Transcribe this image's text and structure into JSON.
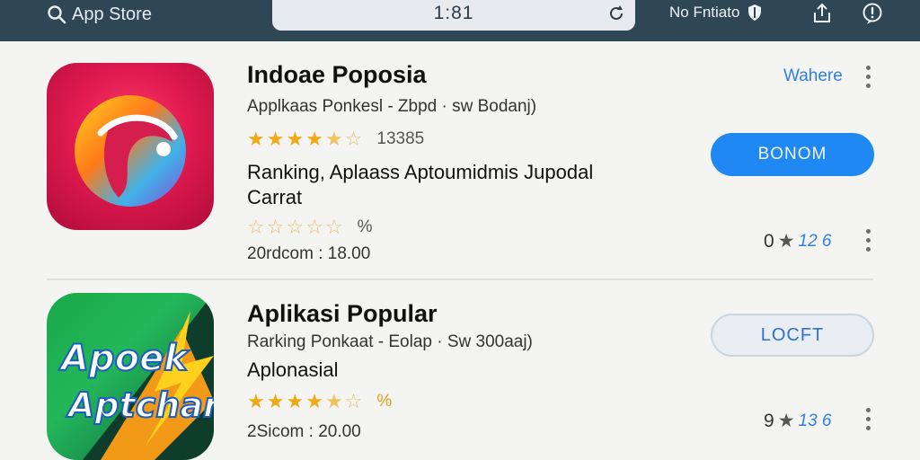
{
  "topbar": {
    "back_label": "App Store",
    "url_text": "1:81",
    "status_text": "No Fntiato"
  },
  "apps": [
    {
      "title": "Indoae Poposia",
      "subtitle": "Applkaas Ponkesl  -  Zbpd · sw  Bodanj)",
      "rating_count": "13385",
      "description_line1": "Ranking,  Aplaass Aptoumidmis Jupodal",
      "description_line2": "Carrat",
      "secondary_rating_text": "%",
      "meta": "20rdcom  :  18.00",
      "link_label": "Wahere",
      "button_label": "BONOM",
      "mini_rating_value": "0",
      "mini_rating_label": "12 6"
    },
    {
      "title": "Aplikasi Popular",
      "subtitle": "Rarking Ponkaat  -  Eolap · Sw  300aaj)",
      "description_line1": "Aplonasial",
      "rating_text": "%",
      "meta": "2Sicom  :  20.00",
      "button_label": "LOCFT",
      "mini_rating_value": "9",
      "mini_rating_label": "13 6",
      "icon_text_line1": "Apoek",
      "icon_text_line2": "Aptchar"
    }
  ],
  "colors": {
    "topbar": "#2f4654",
    "primary_button": "#1f88f2",
    "star": "#f0a814",
    "link": "#2f7fe0"
  }
}
